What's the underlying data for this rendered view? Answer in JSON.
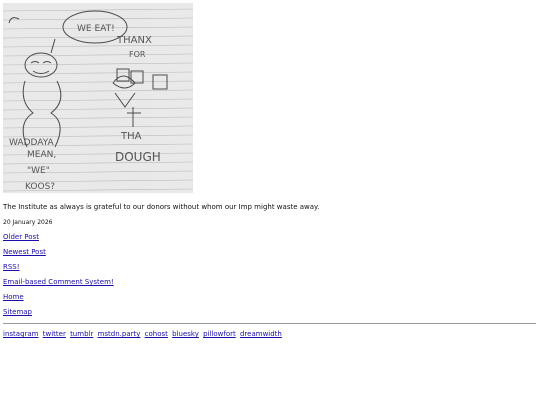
{
  "post": {
    "image_alt": "Hand-drawn cartoon: figure with speech bubble \"WE EAT!\" and an imp holding bags, text \"THANX FOR THA DOUGH\" and \"WADDAYA MEAN, \"WE\" KOOS?\"",
    "drawing_text": {
      "bubble": "WE EAT!",
      "thanx": "THANX",
      "for": "FOR",
      "tha": "THA",
      "dough": "DOUGH",
      "waddaya": "WADDAYA",
      "mean": "MEAN,",
      "we": "\"WE\"",
      "koos": "KOOS?"
    },
    "caption": "The Institute as always is grateful to our donors without whom our Imp might waste away.",
    "date": "20 January 2026"
  },
  "nav": {
    "older": "Older Post",
    "newest": "Newest Post",
    "rss": "RSS!",
    "email_comments": "Email-based Comment System!",
    "home": "Home",
    "sitemap": "Sitemap"
  },
  "social": [
    "instagram",
    "twitter",
    "tumblr",
    "mstdn.party",
    "cohost",
    "bluesky",
    "pillowfort",
    "dreamwidth"
  ]
}
